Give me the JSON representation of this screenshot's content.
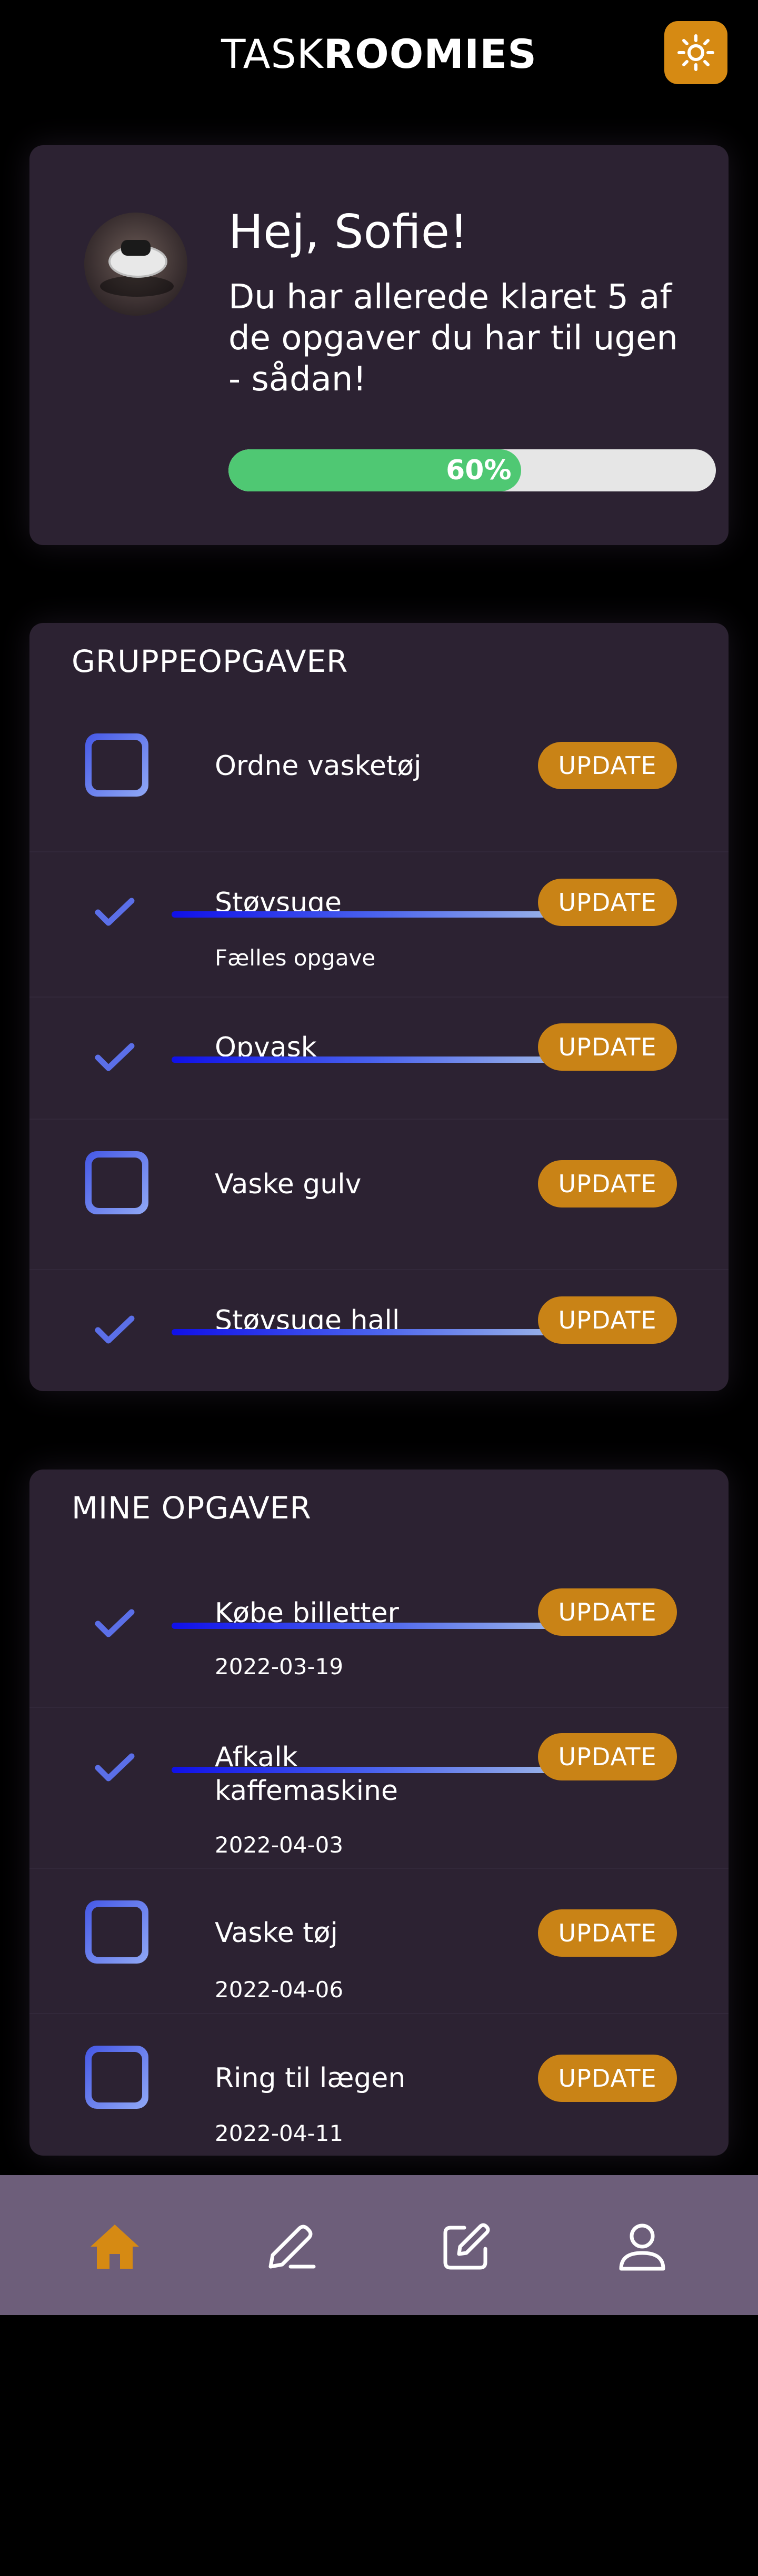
{
  "app": {
    "logo_light": "TASK",
    "logo_bold": "ROOMIES",
    "theme_icon": "sun-icon",
    "accent_color": "#d68a13"
  },
  "welcome": {
    "greeting": "Hej, Sofie!",
    "message": "Du har allerede klaret 5 af de opgaver du har til ugen - sådan!",
    "progress_label": "60%",
    "progress_fraction": 0.6,
    "progress_color": "#4fc873",
    "avatar_icon": "avatar-image"
  },
  "group_tasks": {
    "title": "GRUPPEOPGAVER",
    "items": [
      {
        "label": "Ordne vasketøj",
        "done": false,
        "sub": ""
      },
      {
        "label": "Støvsuge",
        "done": true,
        "sub": "Fælles opgave"
      },
      {
        "label": "Opvask",
        "done": true,
        "sub": ""
      },
      {
        "label": "Vaske gulv",
        "done": false,
        "sub": ""
      },
      {
        "label": "Støvsuge hall",
        "done": true,
        "sub": ""
      }
    ],
    "update_label": "UPDATE"
  },
  "my_tasks": {
    "title": "MINE OPGAVER",
    "items": [
      {
        "label": "Købe billetter",
        "done": true,
        "date": "2022-03-19"
      },
      {
        "label": "Afkalk kaffemaskine",
        "done": true,
        "date": "2022-04-03"
      },
      {
        "label": "Vaske tøj",
        "done": false,
        "date": "2022-04-06"
      },
      {
        "label": "Ring til lægen",
        "done": false,
        "date": "2022-04-11"
      }
    ],
    "update_label": "UPDATE"
  },
  "nav": {
    "items": [
      {
        "icon": "home-icon",
        "active": true
      },
      {
        "icon": "pencil-icon",
        "active": false
      },
      {
        "icon": "edit-icon",
        "active": false
      },
      {
        "icon": "user-icon",
        "active": false
      }
    ],
    "active_color": "#d68a13"
  }
}
